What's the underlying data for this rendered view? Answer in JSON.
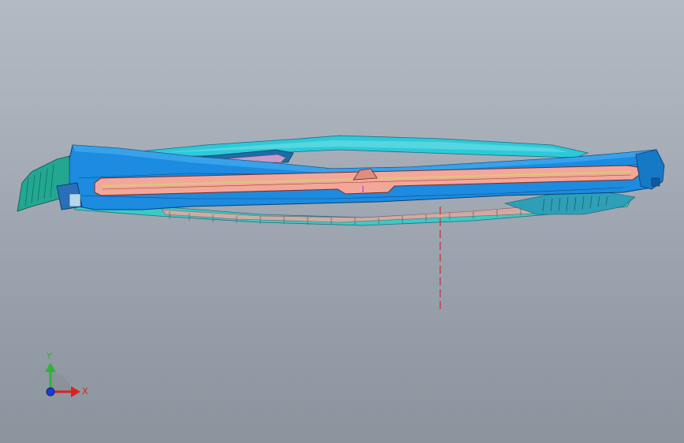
{
  "window": {
    "title": ""
  },
  "triad": {
    "x_label": "X",
    "y_label": "Y",
    "x_color": "#e0201c",
    "y_color": "#2fb23a",
    "z_color": "#1a3ad8"
  },
  "model": {
    "body_color": "#1e8fe0",
    "accent_color": "#1fc6d6",
    "strip_color": "#f2a59a",
    "section_line_color": "#d42a2a"
  }
}
